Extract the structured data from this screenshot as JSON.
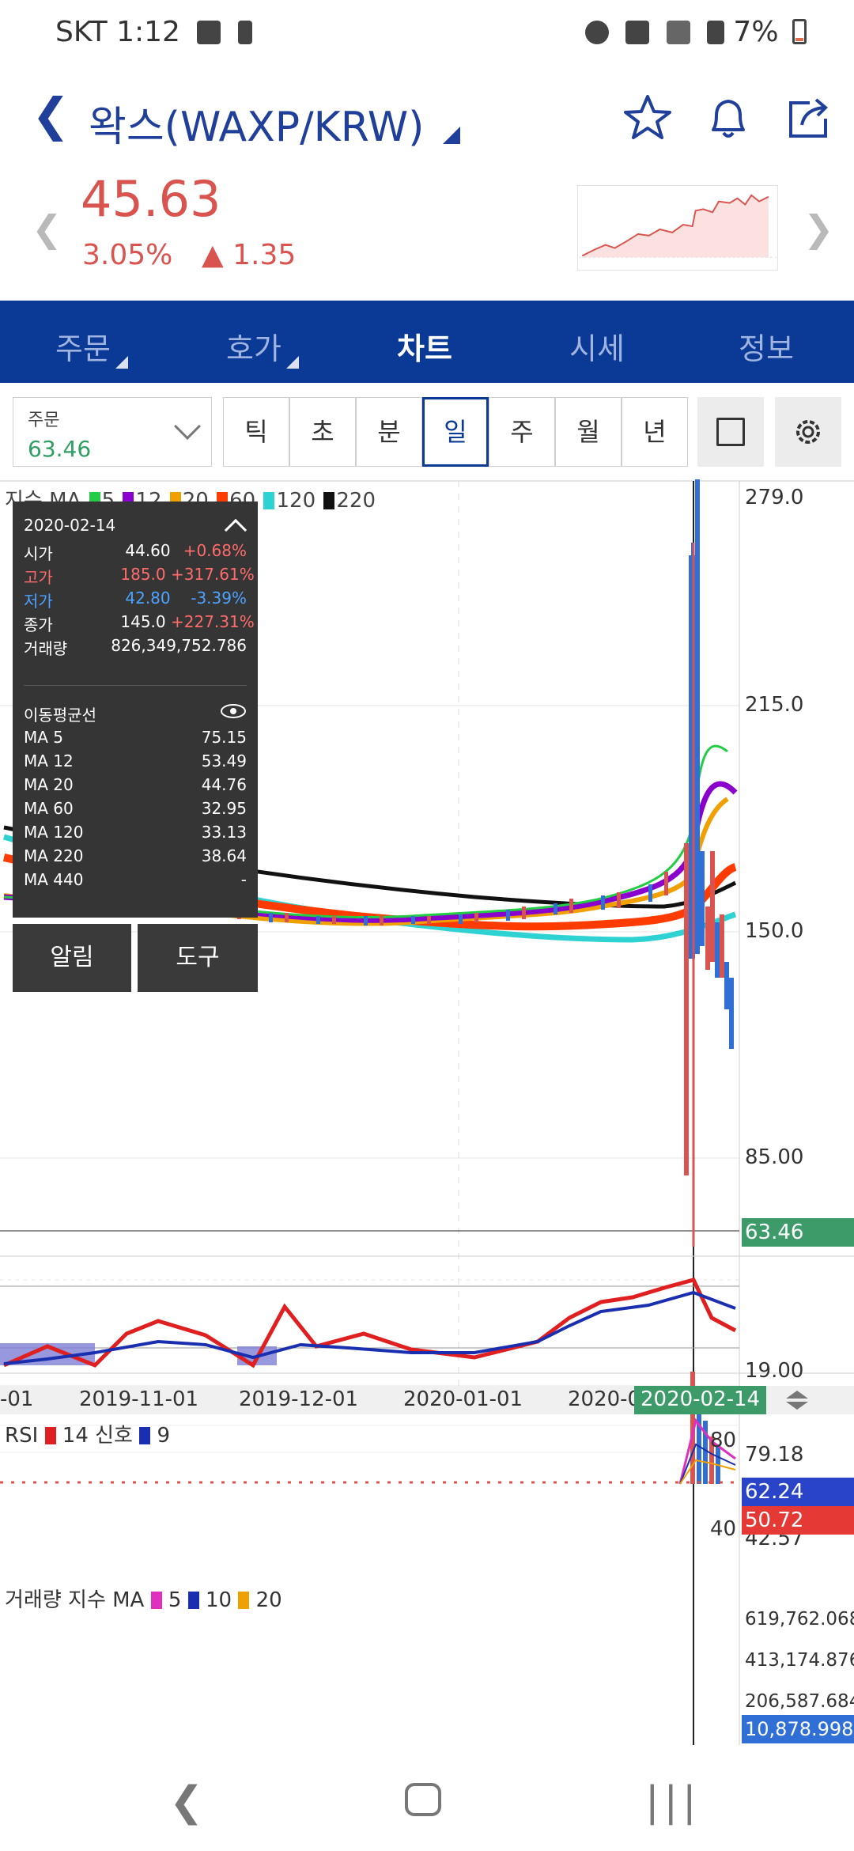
{
  "status": {
    "carrier": "SKT",
    "time": "1:12",
    "battery": "7%"
  },
  "header": {
    "title": "왁스(WAXP/KRW)"
  },
  "price": {
    "current": "45.63",
    "change_pct": "3.05%",
    "change_abs": "▲ 1.35"
  },
  "tabs": [
    {
      "label": "주문"
    },
    {
      "label": "호가"
    },
    {
      "label": "차트"
    },
    {
      "label": "시세"
    },
    {
      "label": "정보"
    }
  ],
  "order": {
    "label": "주문",
    "value": "63.46"
  },
  "periods": [
    "틱",
    "초",
    "분",
    "일",
    "주",
    "월",
    "년"
  ],
  "ma_legend": {
    "prefix": "지수 MA",
    "items": [
      "5",
      "12",
      "20",
      "60",
      "120",
      "220"
    ]
  },
  "ohlc": {
    "date": "2020-02-14",
    "rows": [
      {
        "k": "시가",
        "v": "44.60",
        "c": "+0.68%"
      },
      {
        "k": "고가",
        "v": "185.0",
        "c": "+317.61%"
      },
      {
        "k": "저가",
        "v": "42.80",
        "c": "-3.39%"
      },
      {
        "k": "종가",
        "v": "145.0",
        "c": "+227.31%"
      },
      {
        "k": "거래량",
        "v": "826,349,752.786",
        "c": ""
      }
    ],
    "ma_title": "이동평균선",
    "ma_rows": [
      {
        "k": "MA 5",
        "v": "75.15"
      },
      {
        "k": "MA 12",
        "v": "53.49"
      },
      {
        "k": "MA 20",
        "v": "44.76"
      },
      {
        "k": "MA 60",
        "v": "32.95"
      },
      {
        "k": "MA 120",
        "v": "33.13"
      },
      {
        "k": "MA 220",
        "v": "38.64"
      },
      {
        "k": "MA 440",
        "v": "-"
      }
    ]
  },
  "buttons": {
    "alert": "알림",
    "tool": "도구"
  },
  "price_axis": [
    "279.0",
    "215.0",
    "150.0",
    "85.00",
    "19.00"
  ],
  "price_tags": {
    "current": "63.46"
  },
  "dates": [
    "-01",
    "2019-11-01",
    "2019-12-01",
    "2020-01-01",
    "2020-0",
    "2020-02-14"
  ],
  "rsi": {
    "legend": "RSI",
    "period": "14",
    "signal_label": "신호",
    "signal_period": "9",
    "axis": [
      "79.18",
      "42.57"
    ],
    "upper": "80",
    "lower": "40",
    "tag1": "62.24",
    "tag2": "50.72"
  },
  "volume": {
    "legend": "거래량 지수 MA",
    "items": [
      "5",
      "10",
      "20"
    ],
    "axis": [
      "619,762.068",
      "413,174.876",
      "206,587.684"
    ],
    "tag": "10,878.998"
  },
  "colors": {
    "brand": "#0b3996",
    "up": "#d9534f",
    "down": "#2f6fd6"
  }
}
